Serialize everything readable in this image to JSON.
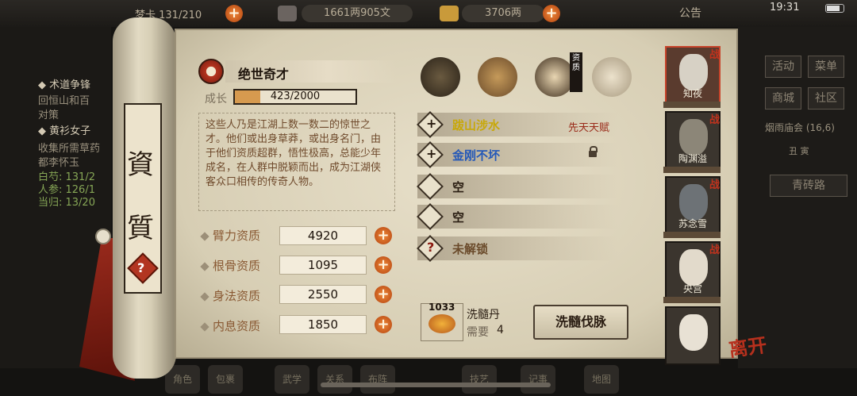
{
  "topbar": {
    "left_text": "梦卡 131/210",
    "silver_text": "1661两905文",
    "gold_text": "3706两",
    "notice": "公告",
    "clock": "19:31"
  },
  "background_left": {
    "lines": [
      "◆ 术道争锋",
      "回恒山和百",
      "对策",
      "◆ 黄衫女子",
      "收集所需草药",
      "都李怀玉",
      "白芍: 131/2",
      "人参: 126/1",
      "当归: 13/20"
    ]
  },
  "background_right": {
    "buttons": [
      "活动",
      "菜单",
      "商城",
      "社区"
    ],
    "event_text": "烟雨庙会 (16,6)",
    "time_text": "丑 寅",
    "location": "青砖路"
  },
  "bottom_nav": [
    "角色",
    "包裹",
    "武学",
    "关系",
    "布阵",
    "技艺",
    "记事",
    "地图"
  ],
  "scroll": {
    "char1": "資",
    "char2": "質",
    "help": "?"
  },
  "talent": {
    "name": "绝世奇才",
    "growth_label": "成长",
    "growth_value": "423/2000",
    "growth_fraction": 0.2115,
    "description": "这些人乃是江湖上数一数二的惊世之才。他们或出身草莽，或出身名门，由于他们资质超群，悟性极高，总能少年成名，在人群中脱颖而出，成为江湖侠客众口相传的传奇人物。"
  },
  "attributes": [
    {
      "label": "臂力资质",
      "value": "4920"
    },
    {
      "label": "根骨资质",
      "value": "1095"
    },
    {
      "label": "身法资质",
      "value": "2550"
    },
    {
      "label": "内息资质",
      "value": "1850"
    }
  ],
  "character_badge": "资质",
  "skills": [
    {
      "mark": "+",
      "name": "跋山涉水",
      "color": "#c8a80a",
      "tag": "先天天赋"
    },
    {
      "mark": "+",
      "name": "金刚不坏",
      "color": "#2458b8",
      "locked": true
    },
    {
      "mark": "",
      "name": "空",
      "color": "#2a1d12"
    },
    {
      "mark": "",
      "name": "空",
      "color": "#2a1d12"
    },
    {
      "mark": "?",
      "name": "未解锁",
      "color": "#6a4a2a"
    }
  ],
  "item": {
    "count": "1033",
    "name": "洗髓丹",
    "need_label": "需要",
    "need_value": "4",
    "button": "洗髓伐脉"
  },
  "party": [
    {
      "name": "知夜",
      "tag": "战",
      "selected": true
    },
    {
      "name": "陶渊溢",
      "tag": "战"
    },
    {
      "name": "苏念雪",
      "tag": "战"
    },
    {
      "name": "央宫",
      "tag": "战"
    },
    {
      "name": ""
    }
  ],
  "leave_text": "离开",
  "colors": {
    "accent_red": "#c0321d",
    "orange_plus": "#e07028",
    "parchment": "#e0d8c1"
  }
}
